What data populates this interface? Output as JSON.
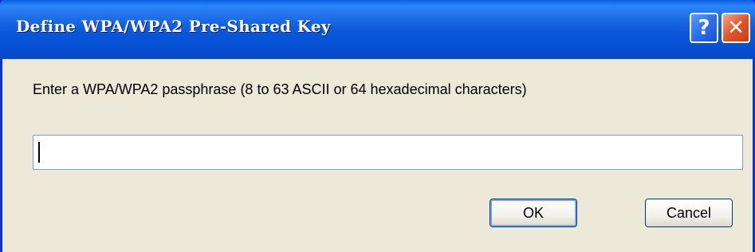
{
  "window": {
    "title": "Define WPA/WPA2 Pre-Shared Key",
    "help_glyph": "?",
    "close_glyph": "✕"
  },
  "dialog": {
    "prompt": "Enter a WPA/WPA2 passphrase (8 to 63 ASCII or 64 hexadecimal characters)",
    "passphrase_value": ""
  },
  "buttons": {
    "ok_label": "OK",
    "cancel_label": "Cancel"
  },
  "icons": {
    "help": "help-icon",
    "close": "close-icon"
  },
  "colors": {
    "titlebar": "#0a56d8",
    "close_button": "#e2562c",
    "dialog_background": "#ece9d8"
  }
}
